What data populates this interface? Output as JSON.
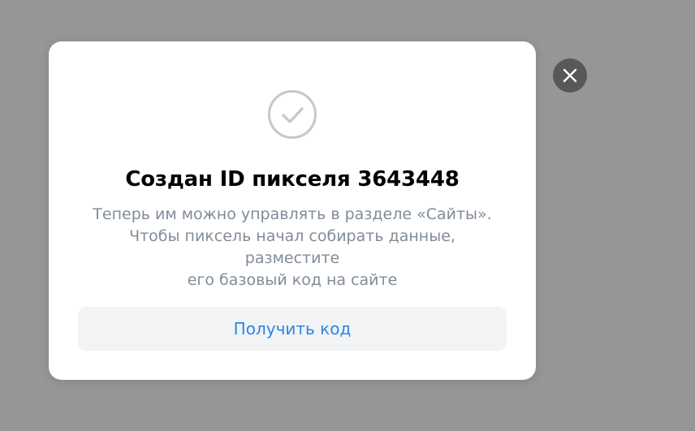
{
  "modal": {
    "icon": "check-circle-icon",
    "title": "Создан ID пикселя 3643448",
    "description_lines": [
      "Теперь им можно управлять в разделе «Сайты».",
      "Чтобы пиксель начал собирать данные, разместите",
      "его базовый код на сайте"
    ],
    "primary_button_label": "Получить код",
    "close_icon": "close-icon"
  },
  "colors": {
    "overlay": "#969696",
    "modal_background": "#ffffff",
    "title": "#000000",
    "description": "#818c99",
    "button_background": "#f2f3f5",
    "button_text": "#2b85e4",
    "check_icon": "#c4c8cc",
    "close_button_background": "#585858",
    "close_icon": "#ffffff"
  }
}
